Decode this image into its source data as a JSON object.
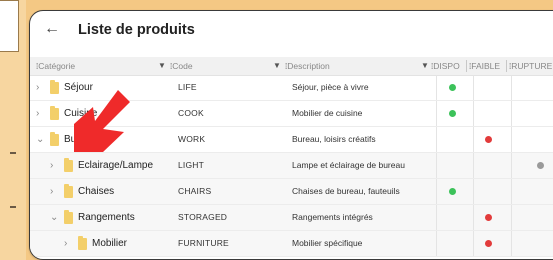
{
  "app": {
    "title": "Liste de produits",
    "back_icon": "arrow-left-icon"
  },
  "columns": {
    "categorie": "Catégorie",
    "code": "Code",
    "description": "Description",
    "dispo": "DISPO",
    "faible": "FAIBLE",
    "rupture": "RUPTURE"
  },
  "status_colors": {
    "dispo": "#3cc25a",
    "faible": "#e23b3b",
    "rupture": "#9a9a9a"
  },
  "rows": [
    {
      "level": 0,
      "expanded": false,
      "name": "Séjour",
      "code": "LIFE",
      "description": "Séjour, pièce à vivre",
      "status": "dispo"
    },
    {
      "level": 0,
      "expanded": false,
      "name": "Cuisine",
      "code": "COOK",
      "description": "Mobilier de cuisine",
      "status": "dispo"
    },
    {
      "level": 0,
      "expanded": true,
      "name": "Bureau",
      "code": "WORK",
      "description": "Bureau, loisirs créatifs",
      "status": "faible"
    },
    {
      "level": 1,
      "expanded": false,
      "name": "Eclairage/Lampe",
      "code": "LIGHT",
      "description": "Lampe et éclairage de bureau",
      "status": "rupture"
    },
    {
      "level": 1,
      "expanded": false,
      "name": "Chaises",
      "code": "CHAIRS",
      "description": "Chaises de bureau, fauteuils",
      "status": "dispo"
    },
    {
      "level": 1,
      "expanded": true,
      "name": "Rangements",
      "code": "STORAGED",
      "description": "Rangements intégrés",
      "status": "faible"
    },
    {
      "level": 2,
      "expanded": false,
      "name": "Mobilier",
      "code": "FURNITURE",
      "description": "Mobilier spécifique",
      "status": "faible"
    }
  ]
}
